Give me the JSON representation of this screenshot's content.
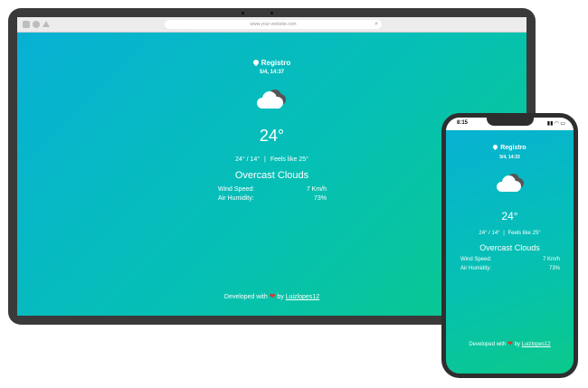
{
  "browser": {
    "url": "www.your-website.com"
  },
  "desktop": {
    "city": "Registro",
    "datetime": "5/4, 14:37",
    "temperature": "24°",
    "minmax": "24° / 14°",
    "feels_like": "Feels like 25°",
    "description": "Overcast Clouds",
    "wind_label": "Wind Speed:",
    "wind_value": "7 Km/h",
    "humidity_label": "Air Humidity:",
    "humidity_value": "73%",
    "footer_prefix": "Developed with",
    "footer_by": "by",
    "footer_author": "Luizlopes12"
  },
  "phone": {
    "status_time": "8:15",
    "city": "Registro",
    "datetime": "5/4, 14:33",
    "temperature": "24°",
    "minmax": "24° / 14°",
    "feels_like": "Feels like 25°",
    "description": "Overcast Clouds",
    "wind_label": "Wind Speed:",
    "wind_value": "7 Km/h",
    "humidity_label": "Air Humidity:",
    "humidity_value": "73%",
    "footer_prefix": "Developed with",
    "footer_by": "by",
    "footer_author": "Luizlopes12"
  },
  "icons": {
    "location": "location-pin-icon",
    "weather": "overcast-clouds-icon",
    "heart": "heart-icon",
    "search": "search-icon"
  },
  "colors": {
    "gradient_start": "#08b0d6",
    "gradient_end": "#0bc98a",
    "heart": "#e0342a"
  }
}
